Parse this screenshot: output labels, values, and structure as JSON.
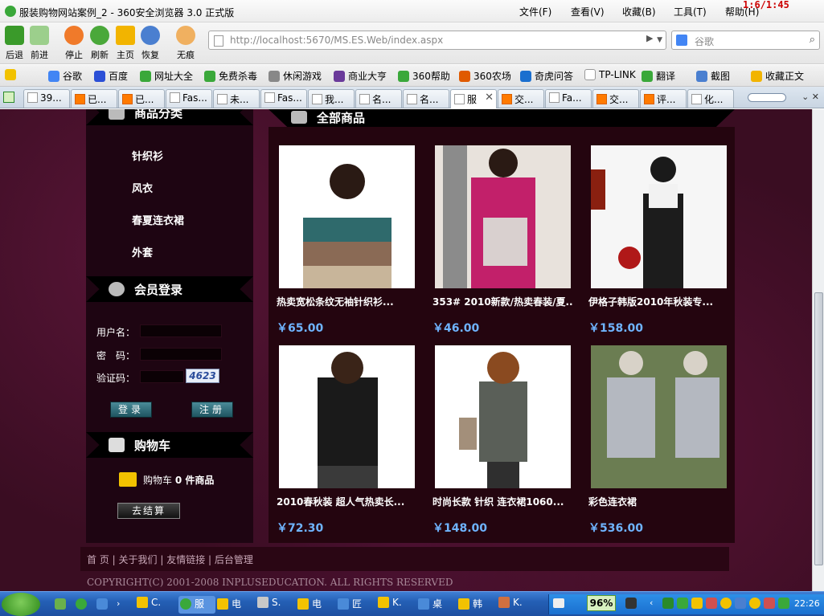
{
  "window": {
    "title": "服装购物网站案例_2 - 360安全浏览器 3.0 正式版",
    "timer": "1:6/1:45",
    "menus": [
      "文件(F)",
      "查看(V)",
      "收藏(B)",
      "工具(T)",
      "帮助(H)"
    ]
  },
  "nav": {
    "buttons": [
      "后退",
      "前进",
      "停止",
      "刷新",
      "主页",
      "恢复",
      "无痕"
    ],
    "url": "http://localhost:5670/MS.ES.Web/index.aspx",
    "search_placeholder": "谷歌"
  },
  "favorites": [
    "谷歌",
    "百度",
    "网址大全",
    "免费杀毒",
    "休闲游戏",
    "商业大亨",
    "360帮助",
    "360农场",
    "奇虎问答",
    "TP-LINK",
    "翻译",
    "截图",
    "收藏正文"
  ],
  "tabs": [
    {
      "label": "39...",
      "icon": "page"
    },
    {
      "label": "已...",
      "icon": "taobao"
    },
    {
      "label": "已...",
      "icon": "taobao"
    },
    {
      "label": "Fas...",
      "icon": "page"
    },
    {
      "label": "未...",
      "icon": "page"
    },
    {
      "label": "Fas...",
      "icon": "page"
    },
    {
      "label": "我...",
      "icon": "page"
    },
    {
      "label": "名...",
      "icon": "page"
    },
    {
      "label": "名...",
      "icon": "page"
    },
    {
      "label": "服",
      "icon": "page",
      "active": true
    },
    {
      "label": "交...",
      "icon": "taobao"
    },
    {
      "label": "Fa...",
      "icon": "page"
    },
    {
      "label": "交...",
      "icon": "taobao"
    },
    {
      "label": "评...",
      "icon": "taobao"
    },
    {
      "label": "化...",
      "icon": "page"
    }
  ],
  "sidebar": {
    "category_title": "商品分类",
    "categories": [
      "针织衫",
      "风衣",
      "春夏连衣裙",
      "外套"
    ],
    "login_title": "会员登录",
    "username_label": "用户名：",
    "password_label": "密　码：",
    "captcha_label": "验证码：",
    "captcha_value": "4623",
    "login_button": "登录",
    "register_button": "注册",
    "cart_title": "购物车",
    "cart_text": "购物车",
    "cart_count": "0 件商品",
    "checkout_button": "去结算"
  },
  "main": {
    "title": "全部商品",
    "products": [
      {
        "name": "热卖宽松条纹无袖针织衫...",
        "price": "￥65.00",
        "colors": [
          "#2f6a6c",
          "#8a6a55",
          "#c8b59a"
        ]
      },
      {
        "name": "353# 2010新款/热卖春装/夏...",
        "price": "￥46.00",
        "colors": [
          "#c2206a",
          "#d9d0cf",
          "#8b8b8b"
        ]
      },
      {
        "name": "伊格子韩版2010年秋装专...",
        "price": "￥158.00",
        "colors": [
          "#1c1c1c",
          "#f2f2f2",
          "#b01818"
        ]
      },
      {
        "name": "2010春秋装 超人气热卖长...",
        "price": "￥72.30",
        "colors": [
          "#1a1a1a",
          "#3a3a3a",
          "#c9c4bf"
        ]
      },
      {
        "name": "时尚长款 针织 连衣裙1060...",
        "price": "￥148.00",
        "colors": [
          "#5a5f58",
          "#2f2f2f",
          "#a38f7a"
        ]
      },
      {
        "name": "彩色连衣裙",
        "price": "￥536.00",
        "colors": [
          "#b4b8c0",
          "#6b7d52",
          "#d8d2c8"
        ]
      }
    ]
  },
  "footer": {
    "links": [
      "首 页",
      "关于我们",
      "友情链接",
      "后台管理"
    ],
    "copyright": "COPYRIGHT(C) 2001-2008 INPLUSEDUCATION. ALL RIGHTS RESERVED"
  },
  "taskbar": {
    "items": [
      "C.",
      "服",
      "电",
      "S.",
      "电",
      "匠",
      "K.",
      "桌",
      "韩",
      "K."
    ],
    "battery": "96%",
    "clock": "22:26"
  }
}
